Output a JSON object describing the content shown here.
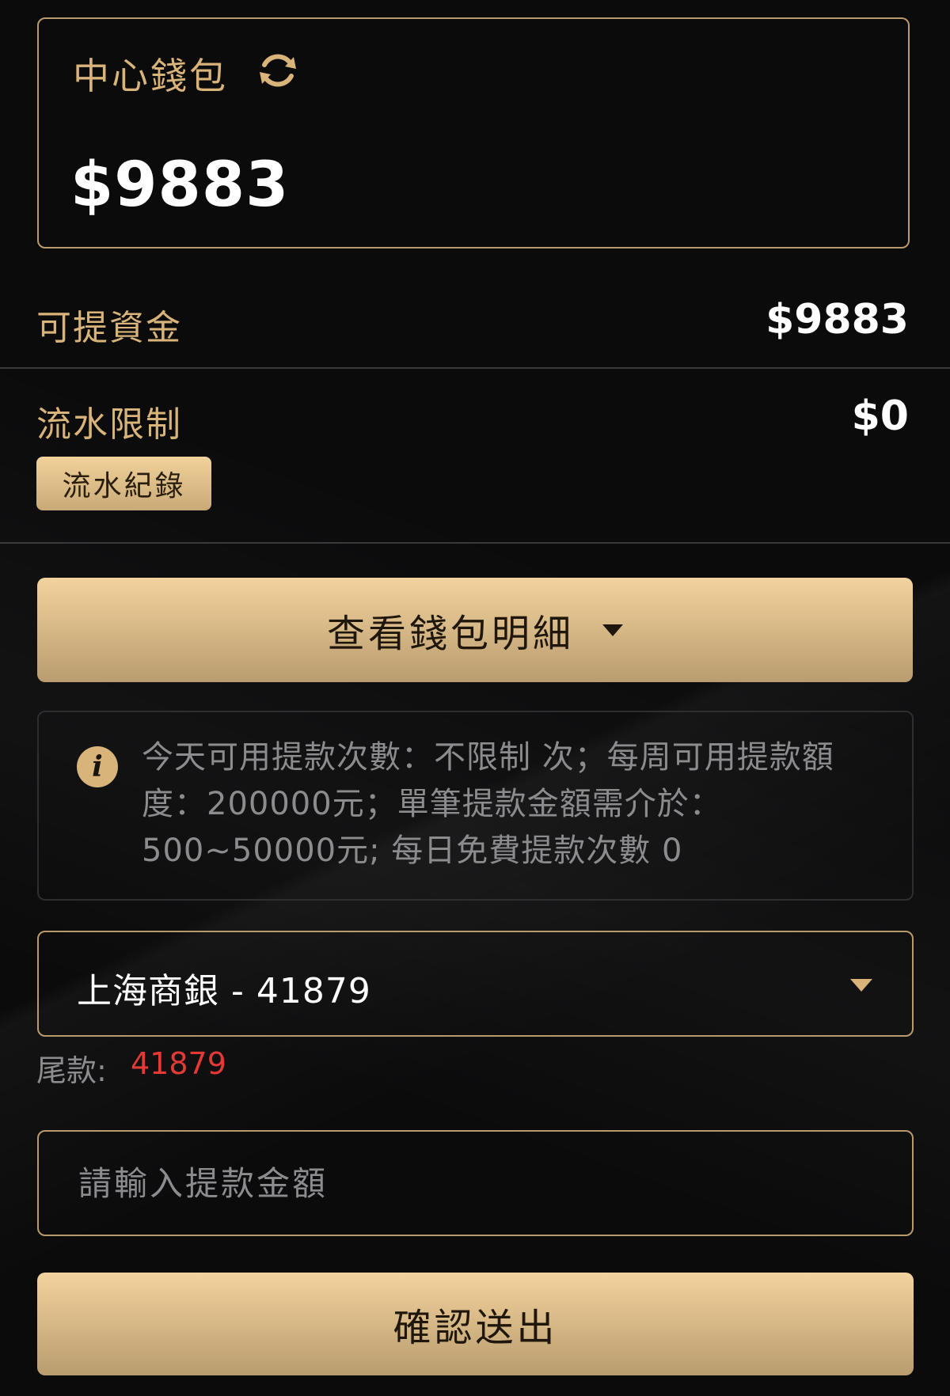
{
  "wallet": {
    "title": "中心錢包",
    "amount": "$9883",
    "refresh_icon": "refresh-icon"
  },
  "withdrawable": {
    "label": "可提資金",
    "value": "$9883"
  },
  "turnover": {
    "label": "流水限制",
    "value": "$0",
    "records_button": "流水紀錄"
  },
  "details_button": {
    "label": "查看錢包明細",
    "icon": "chevron-down-icon"
  },
  "info": {
    "icon": "info-icon",
    "text": "今天可用提款次數：不限制 次；每周可用提款額度：200000元；單筆提款金額需介於：500~50000元; 每日免費提款次數 0"
  },
  "bank_select": {
    "value": "上海商銀 - 41879",
    "icon": "chevron-down-icon"
  },
  "tail": {
    "label": "尾款:",
    "value": "41879"
  },
  "amount_input": {
    "placeholder": "請輸入提款金額",
    "value": ""
  },
  "submit_button": {
    "label": "確認送出"
  },
  "colors": {
    "gold": "#d9b47a",
    "red": "#e53935",
    "background": "#0b0b0c"
  }
}
